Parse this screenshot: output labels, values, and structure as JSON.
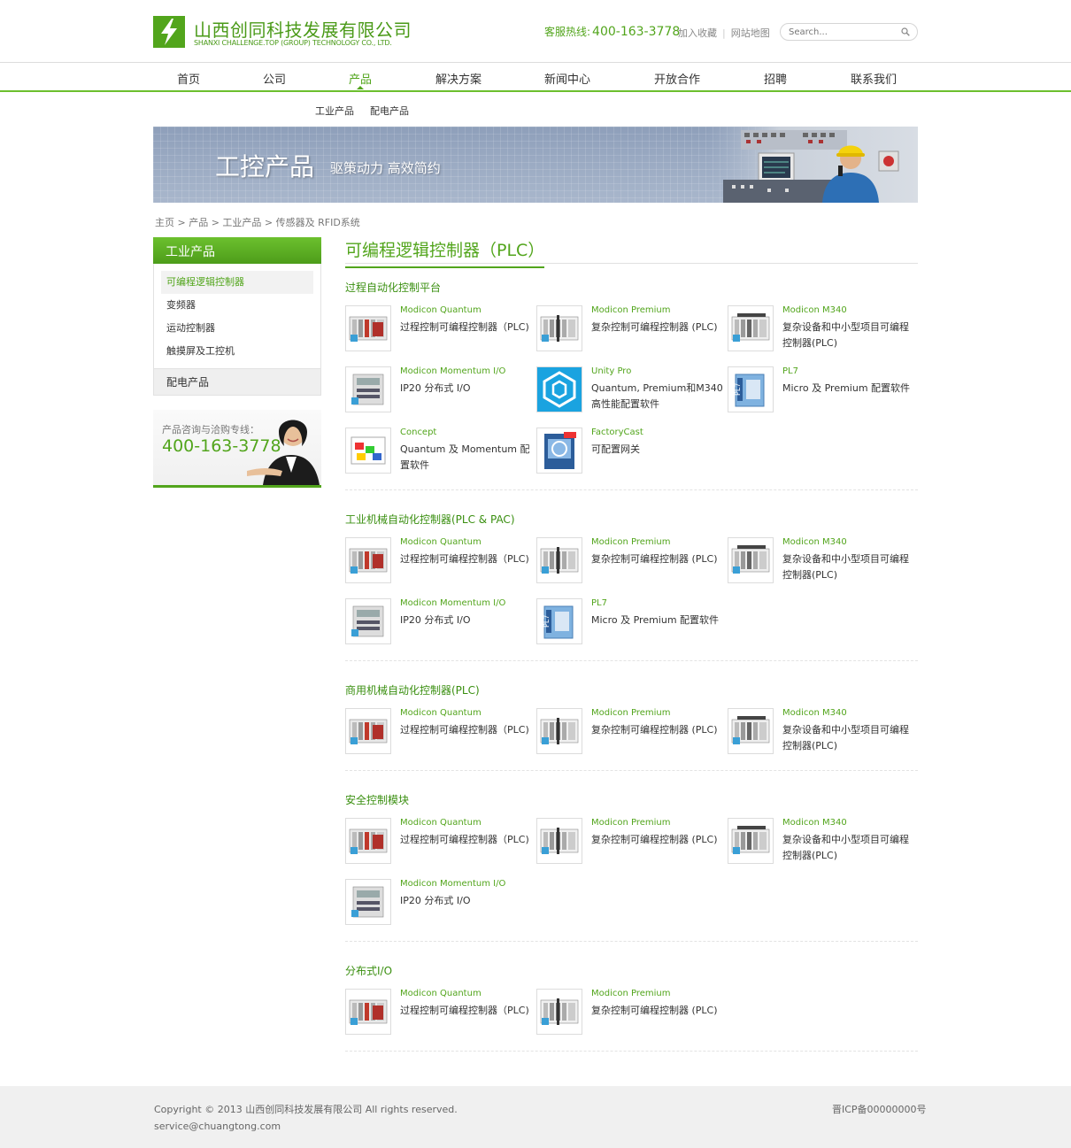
{
  "brand": {
    "name_cn": "山西创同科技发展有限公司",
    "name_en": "SHANXI CHALLENGE.TOP (GROUP) TECHNOLOGY CO., LTD.",
    "logo_icon": "lightning-logo-icon",
    "accent_color": "#52a51c"
  },
  "topbar": {
    "hotline_label": "客服热线:",
    "hotline_number": "400-163-3778",
    "bookmark_link": "加入收藏",
    "sitemap_link": "网站地图",
    "search_placeholder": "Search..."
  },
  "nav": {
    "items": [
      "首页",
      "公司",
      "产品",
      "解决方案",
      "新闻中心",
      "开放合作",
      "招聘",
      "联系我们"
    ],
    "active_index": 2
  },
  "subnav": [
    "工业产品",
    "配电产品"
  ],
  "banner": {
    "title": "工控产品",
    "subtitle": "驱策动力 高效简约"
  },
  "breadcrumb": "主页 > 产品 > 工业产品 > 传感器及 RFID系统",
  "sidebar": {
    "heading": "工业产品",
    "items": [
      "可编程逻辑控制器",
      "变频器",
      "运动控制器",
      "触摸屏及工控机"
    ],
    "active_index": 0,
    "category": "配电产品",
    "contact_label": "产品咨询与洽购专线：",
    "contact_number": "400-163-3778"
  },
  "main": {
    "title": "可编程逻辑控制器（PLC）",
    "sections": [
      {
        "title": "过程自动化控制平台",
        "products": [
          {
            "name": "Modicon Quantum",
            "desc": "过程控制可编程控制器（PLC)",
            "icon": "quantum"
          },
          {
            "name": "Modicon Premium",
            "desc": "复杂控制可编程控制器 (PLC)",
            "icon": "premium"
          },
          {
            "name": "Modicon M340",
            "desc": "复杂设备和中小型项目可编程控制器(PLC)",
            "icon": "m340"
          },
          {
            "name": "Modicon Momentum I/O",
            "desc": "IP20 分布式 I/O",
            "icon": "momentum"
          },
          {
            "name": "Unity Pro",
            "desc": "Quantum, Premium和M340高性能配置软件",
            "icon": "unity"
          },
          {
            "name": "PL7",
            "desc": "Micro 及 Premium 配置软件",
            "icon": "pl7"
          },
          {
            "name": "Concept",
            "desc": "Quantum 及 Momentum 配置软件",
            "icon": "concept"
          },
          {
            "name": "FactoryCast",
            "desc": "可配置网关",
            "icon": "factorycast"
          }
        ]
      },
      {
        "title": "工业机械自动化控制器(PLC & PAC)",
        "products": [
          {
            "name": "Modicon Quantum",
            "desc": "过程控制可编程控制器（PLC)",
            "icon": "quantum"
          },
          {
            "name": "Modicon Premium",
            "desc": "复杂控制可编程控制器 (PLC)",
            "icon": "premium"
          },
          {
            "name": "Modicon M340",
            "desc": "复杂设备和中小型项目可编程控制器(PLC)",
            "icon": "m340"
          },
          {
            "name": "Modicon Momentum I/O",
            "desc": "IP20 分布式 I/O",
            "icon": "momentum"
          },
          {
            "name": "PL7",
            "desc": "Micro 及 Premium 配置软件",
            "icon": "pl7"
          }
        ]
      },
      {
        "title": "商用机械自动化控制器(PLC)",
        "products": [
          {
            "name": "Modicon Quantum",
            "desc": "过程控制可编程控制器（PLC)",
            "icon": "quantum"
          },
          {
            "name": "Modicon Premium",
            "desc": "复杂控制可编程控制器 (PLC)",
            "icon": "premium"
          },
          {
            "name": "Modicon M340",
            "desc": "复杂设备和中小型项目可编程控制器(PLC)",
            "icon": "m340"
          }
        ]
      },
      {
        "title": "安全控制模块",
        "products": [
          {
            "name": "Modicon Quantum",
            "desc": "过程控制可编程控制器（PLC)",
            "icon": "quantum"
          },
          {
            "name": "Modicon Premium",
            "desc": "复杂控制可编程控制器 (PLC)",
            "icon": "premium"
          },
          {
            "name": "Modicon M340",
            "desc": "复杂设备和中小型项目可编程控制器(PLC)",
            "icon": "m340"
          },
          {
            "name": "Modicon Momentum I/O",
            "desc": "IP20 分布式 I/O",
            "icon": "momentum"
          }
        ]
      },
      {
        "title": "分布式I/O",
        "products": [
          {
            "name": "Modicon Quantum",
            "desc": "过程控制可编程控制器（PLC)",
            "icon": "quantum"
          },
          {
            "name": "Modicon Premium",
            "desc": "复杂控制可编程控制器 (PLC)",
            "icon": "premium"
          }
        ]
      }
    ]
  },
  "footer": {
    "copyright": "Copyright © 2013 山西创同科技发展有限公司 All rights reserved.",
    "email": "service@chuangtong.com",
    "icp": "晋ICP备00000000号"
  }
}
